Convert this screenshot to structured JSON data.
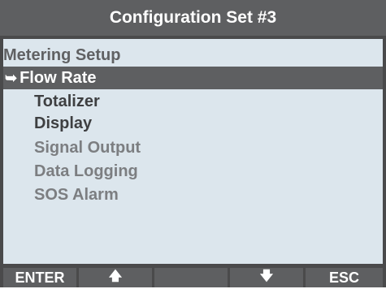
{
  "header": {
    "title": "Configuration Set #3"
  },
  "menu": {
    "section_title": "Metering Setup",
    "items": [
      {
        "label": "Flow Rate",
        "state": "selected"
      },
      {
        "label": "Totalizer",
        "state": "enabled"
      },
      {
        "label": "Display",
        "state": "enabled"
      },
      {
        "label": "Signal Output",
        "state": "disabled"
      },
      {
        "label": "Data Logging",
        "state": "disabled"
      },
      {
        "label": "SOS Alarm",
        "state": "disabled"
      }
    ],
    "selection_marker": "➥"
  },
  "softkeys": {
    "enter": "ENTER",
    "up_icon": "🡅",
    "blank_1": "",
    "down_icon": "🡇",
    "esc": "ESC"
  },
  "colors": {
    "title_bar": "#5e5f61",
    "screen_bg": "#dce6ed",
    "selected_row": "#5e5f61",
    "enabled_text": "#3e3f41",
    "disabled_text": "#7c7e81"
  }
}
